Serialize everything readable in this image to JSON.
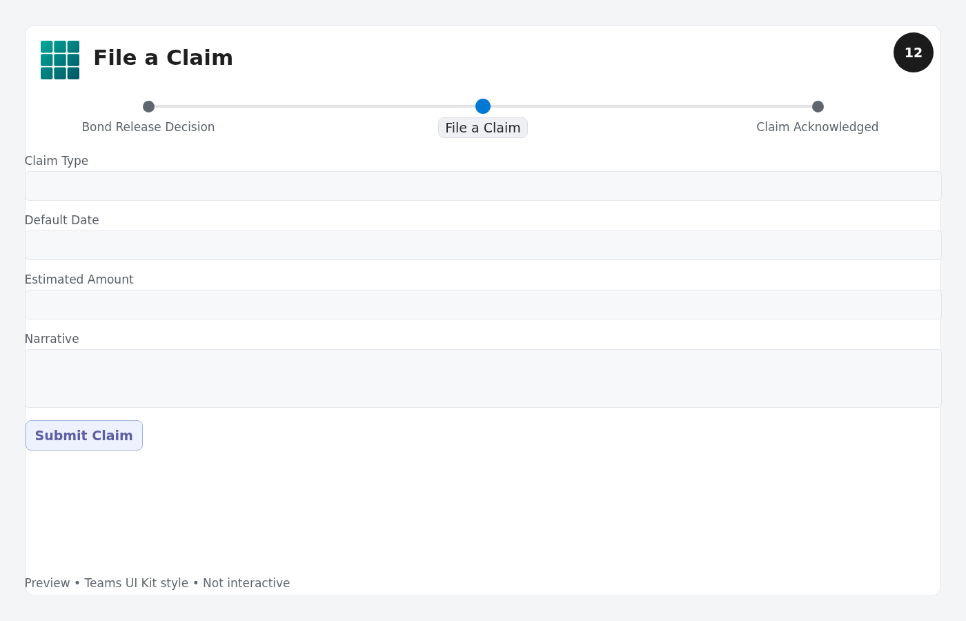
{
  "header": {
    "title": "File a Claim",
    "badge": "12"
  },
  "steps": [
    {
      "label": "Bond Release Decision",
      "selected": false
    },
    {
      "label": "File a Claim",
      "selected": true
    },
    {
      "label": "Claim Acknowledged",
      "selected": false
    }
  ],
  "form": {
    "fields": [
      {
        "label": "Claim Type",
        "kind": "input"
      },
      {
        "label": "Default Date",
        "kind": "input"
      },
      {
        "label": "Estimated Amount",
        "kind": "input"
      },
      {
        "label": "Narrative",
        "kind": "textarea"
      }
    ],
    "submit": "Submit Claim"
  },
  "footer": "Preview • Teams UI Kit style • Not interactive"
}
